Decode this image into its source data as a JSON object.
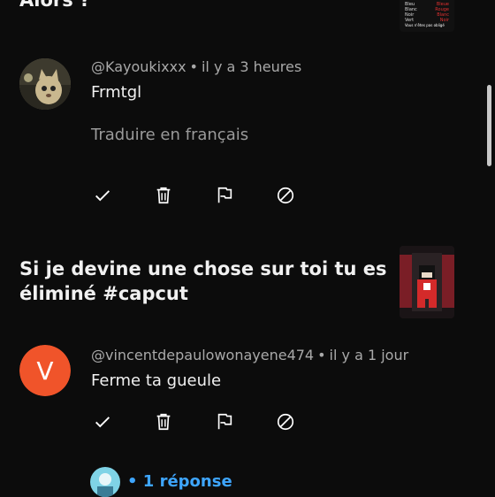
{
  "videos": [
    {
      "title_lines": [
        "Alors ?"
      ],
      "thumb_text": [
        "Bleue",
        "Rouge",
        "Blanc",
        "Noir",
        "Vous n'êtes pas obligé"
      ]
    },
    {
      "title_lines": [
        "Si je devine une chose sur toi tu es",
        "éliminé #capcut"
      ]
    }
  ],
  "comments": [
    {
      "author": "@Kayoukixxx",
      "separator": "•",
      "time": "il y a 3 heures",
      "text": "Frmtgl",
      "translate": "Traduire en français"
    },
    {
      "author": "@vincentdepaulowonayene474",
      "separator": "•",
      "time": "il y a 1 jour",
      "text": "Ferme ta gueule",
      "avatar_letter": "V",
      "avatar_color": "#f0542a"
    }
  ],
  "replies": {
    "separator": "•",
    "label": "1 réponse",
    "color": "#3ea6ff"
  },
  "action_icons": [
    "check-icon",
    "trash-icon",
    "flag-icon",
    "block-icon"
  ]
}
